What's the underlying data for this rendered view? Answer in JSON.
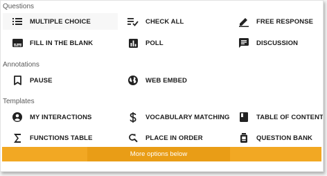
{
  "sections": {
    "questions": "Questions",
    "annotations": "Annotations",
    "templates": "Templates"
  },
  "items": {
    "multiple_choice": {
      "label": "MULTIPLE CHOICE",
      "icon": "list-icon"
    },
    "check_all": {
      "label": "CHECK ALL",
      "icon": "checklist-icon"
    },
    "free_response": {
      "label": "FREE RESPONSE",
      "icon": "pencil-icon"
    },
    "fill_in_blank": {
      "label": "FILL IN THE BLANK",
      "icon": "subtitles-icon"
    },
    "poll": {
      "label": "POLL",
      "icon": "bar-chart-icon"
    },
    "discussion": {
      "label": "DISCUSSION",
      "icon": "comment-icon"
    },
    "pause": {
      "label": "PAUSE",
      "icon": "bookmark-icon"
    },
    "web_embed": {
      "label": "WEB EMBED",
      "icon": "globe-icon"
    },
    "my_interactions": {
      "label": "MY INTERACTIONS",
      "icon": "account-icon"
    },
    "vocabulary_matching": {
      "label": "VOCABULARY MATCHING",
      "icon": "dollar-icon"
    },
    "table_of_contents": {
      "label": "TABLE OF CONTENTS",
      "icon": "book-icon"
    },
    "functions_table": {
      "label": "FUNCTIONS TABLE",
      "icon": "sigma-icon"
    },
    "place_in_order": {
      "label": "PLACE IN ORDER",
      "icon": "find-replace-icon"
    },
    "question_bank": {
      "label": "QUESTION BANK",
      "icon": "bank-icon"
    }
  },
  "more_options": {
    "label": "More options below"
  },
  "colors": {
    "accent": "#f2a823",
    "accent_dark": "#e99d16",
    "text": "#1c1c1c",
    "section_text": "#5a5a5a"
  }
}
